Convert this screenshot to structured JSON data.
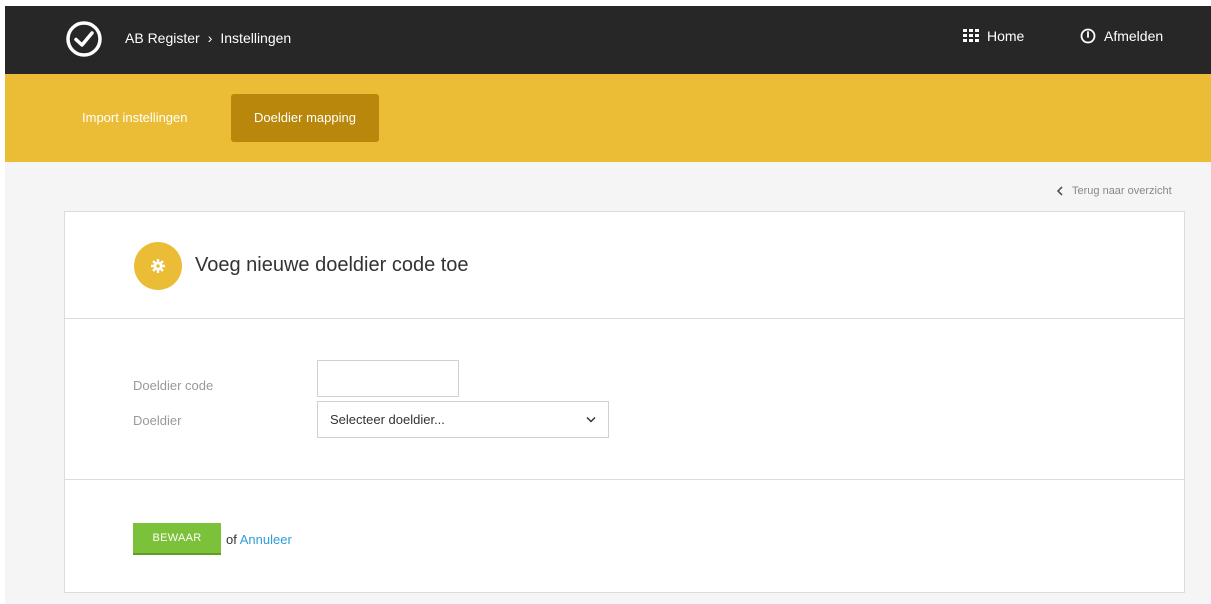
{
  "topbar": {
    "app_name": "AB Register",
    "crumb_separator": "›",
    "current_page": "Instellingen",
    "home_label": "Home",
    "logout_label": "Afmelden",
    "background": "#272727"
  },
  "tabs": [
    {
      "label": "Import instellingen",
      "active": false
    },
    {
      "label": "Doeldier mapping",
      "active": true
    }
  ],
  "tab_colors": {
    "bar": "#ebbd36",
    "active": "#b8870b"
  },
  "back_link": "Terug naar overzicht",
  "card": {
    "title": "Voeg nieuwe doeldier code toe",
    "icon": "gear-icon",
    "fields": {
      "code_label": "Doeldier code",
      "code_value": "",
      "doeldier_label": "Doeldier",
      "doeldier_selected": "Selecteer doeldier..."
    },
    "save_label": "BEWAAR",
    "of_text": "of",
    "cancel_label": "Annuleer",
    "colors": {
      "save": "#7cc13a",
      "link": "#2e9fd8"
    }
  }
}
